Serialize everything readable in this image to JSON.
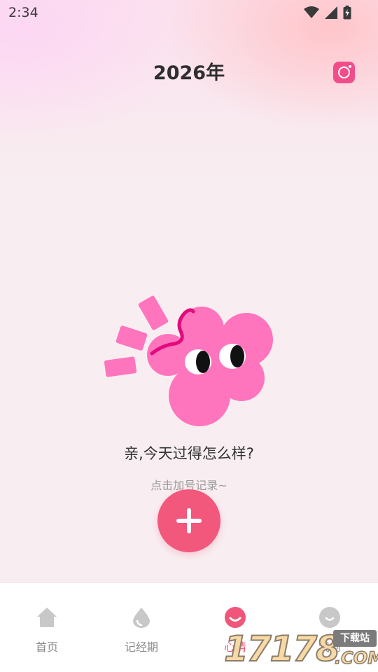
{
  "status_bar": {
    "time": "2:34",
    "icons": [
      "wifi-icon",
      "signal-icon",
      "battery-icon"
    ]
  },
  "header": {
    "title": "2026年",
    "camera_icon": "camera-icon"
  },
  "main": {
    "prompt": "亲,今天过得怎么样?",
    "hint": "点击加号记录~",
    "add_icon": "plus-icon"
  },
  "tabs": [
    {
      "label": "首页",
      "icon": "home-icon",
      "active": false
    },
    {
      "label": "记经期",
      "icon": "drop-icon",
      "active": false
    },
    {
      "label": "心情",
      "icon": "smile-icon",
      "active": true
    },
    {
      "label": "我的",
      "icon": "profile-icon",
      "active": false
    }
  ],
  "watermark": {
    "number": "17178",
    "tag": "下载站",
    "domain": ".COM"
  },
  "colors": {
    "accent": "#f2577c",
    "active_tab": "#f0567a",
    "camera": "#f24d8a",
    "mascot": "#ff75bd",
    "inactive_icon": "#c8c8c8"
  }
}
